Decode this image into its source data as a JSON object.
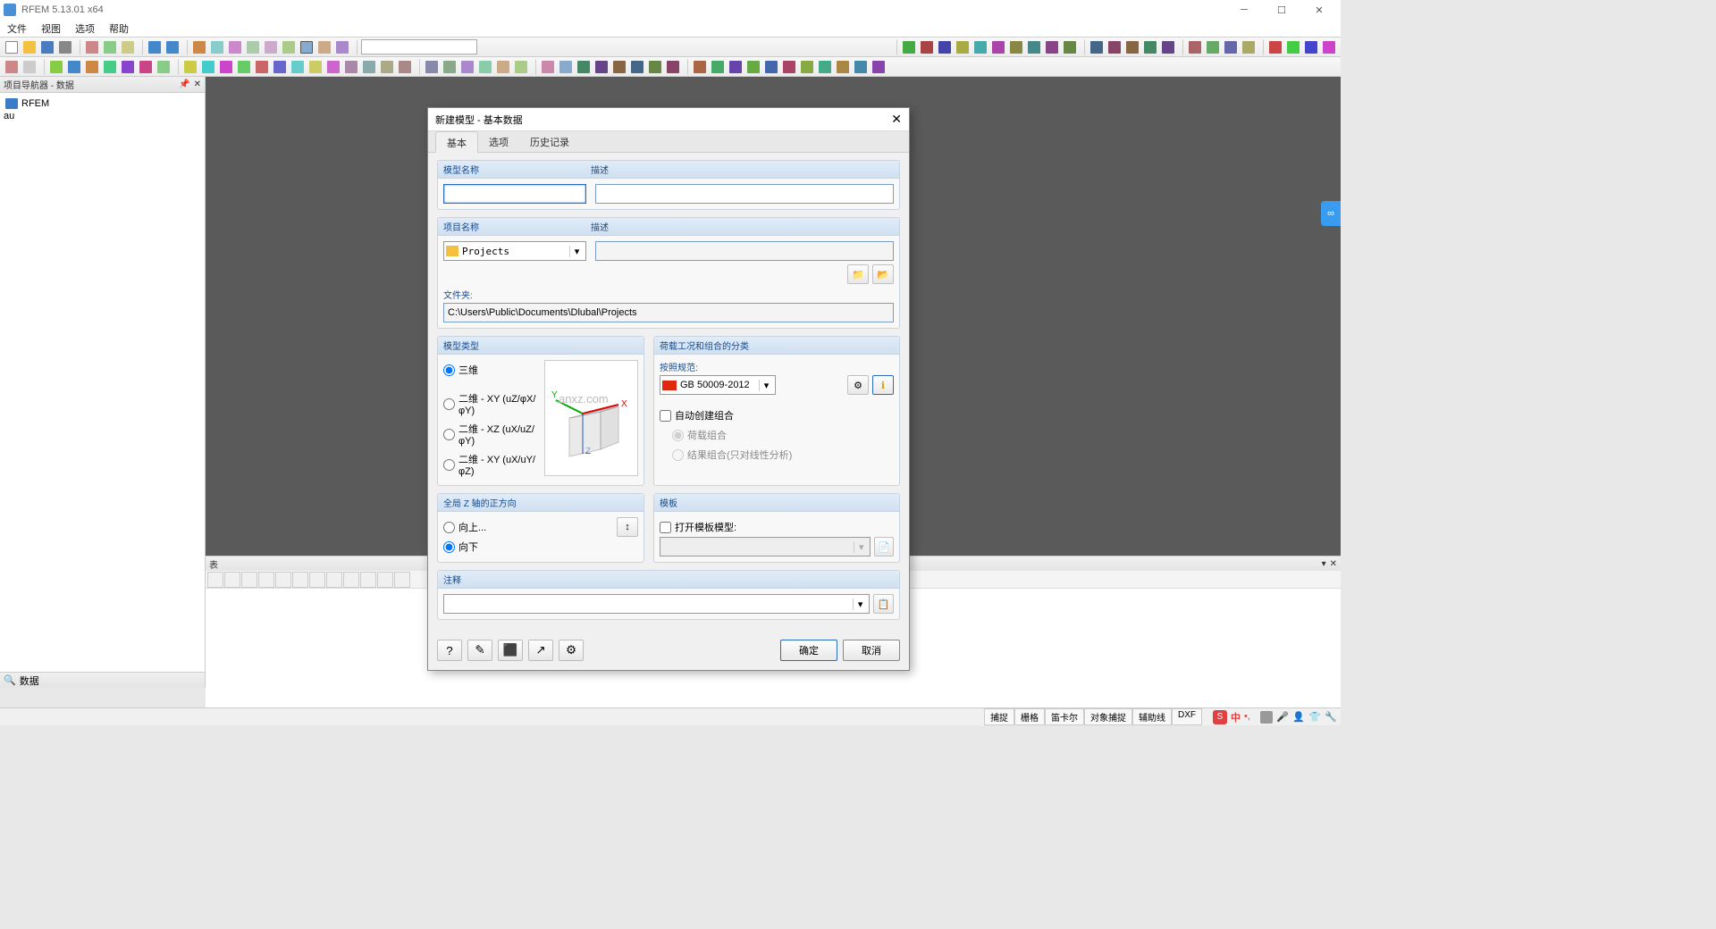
{
  "titlebar": {
    "title": "RFEM 5.13.01 x64"
  },
  "menubar": {
    "items": [
      "文件",
      "视图",
      "选项",
      "帮助"
    ]
  },
  "navigator": {
    "header": "项目导航器 - 数据",
    "root": "RFEM",
    "footer_tab": "数据"
  },
  "tablepanel": {
    "header": "表"
  },
  "statusbar": {
    "cells": [
      "捕捉",
      "栅格",
      "笛卡尔",
      "对象捕捉",
      "辅助线",
      "DXF"
    ],
    "tray_chinese": "中"
  },
  "dialog": {
    "title": "新建模型 - 基本数据",
    "tabs": [
      "基本",
      "选项",
      "历史记录"
    ],
    "labels": {
      "model_name": "模型名称",
      "description": "描述",
      "project_name": "项目名称",
      "folder": "文件夹:",
      "model_type": "模型类型",
      "load_class": "荷载工况和组合的分类",
      "standard": "按照规范:",
      "auto_combo": "自动创建组合",
      "load_combo": "荷载组合",
      "result_combo": "结果组合(只对线性分析)",
      "global_z": "全局 Z 轴的正方向",
      "up": "向上...",
      "down": "向下",
      "template": "模板",
      "open_template": "打开模板模型:",
      "comment": "注释"
    },
    "values": {
      "project_select": "Projects",
      "folder_path": "C:\\Users\\Public\\Documents\\Dlubal\\Projects",
      "standard_value": "GB 50009-2012"
    },
    "model_types": {
      "d3": "三维",
      "xy": "二维 - XY (uZ/φX/φY)",
      "xz": "二维 - XZ (uX/uZ/φY)",
      "xy2": "二维 - XY (uX/uY/φZ)"
    },
    "buttons": {
      "ok": "确定",
      "cancel": "取消"
    }
  },
  "watermark": "anxz.com"
}
